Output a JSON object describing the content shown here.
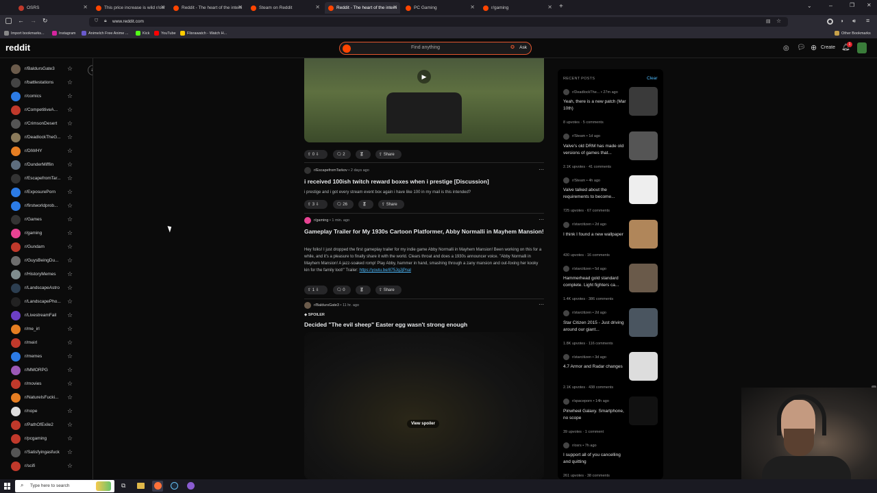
{
  "browser": {
    "tabs": [
      {
        "label": "OSRS",
        "color": "#c0392b"
      },
      {
        "label": "This price increase is wild r/osr",
        "color": "#ff4500"
      },
      {
        "label": "Reddit - The heart of the intern",
        "color": "#ff4500"
      },
      {
        "label": "Steam on Reddit",
        "color": "#ff4500"
      },
      {
        "label": "Reddit - The heart of the intern",
        "color": "#ff4500"
      },
      {
        "label": "PC Gaming",
        "color": "#ff4500"
      },
      {
        "label": "r/gaming",
        "color": "#ff4500"
      }
    ],
    "new_tab": "+",
    "url": "www.reddit.com",
    "bookmarks": [
      {
        "label": "Import bookmarks...",
        "color": "#888"
      },
      {
        "label": "Instagram",
        "color": "#d6249f"
      },
      {
        "label": "Animelch Free Anime ...",
        "color": "#6a5acd"
      },
      {
        "label": "Kick",
        "color": "#53fc18"
      },
      {
        "label": "YouTube",
        "color": "#ff0000"
      },
      {
        "label": "Flixrawatch - Watch H...",
        "color": "#ffcc00"
      }
    ],
    "other_bookmarks": "Other Bookmarks"
  },
  "header": {
    "logo": "reddit",
    "search_placeholder": "Find anything",
    "ask_label": "Ask",
    "create_label": "Create",
    "notif_count": "1"
  },
  "sidebar": {
    "items": [
      {
        "name": "r/BaldursGate3",
        "color": "#6b5b4b"
      },
      {
        "name": "r/battlestations",
        "color": "#444"
      },
      {
        "name": "r/comics",
        "color": "#2c7be5"
      },
      {
        "name": "r/CompetitiveA...",
        "color": "#c0392b"
      },
      {
        "name": "r/CrimsonDesert",
        "color": "#555"
      },
      {
        "name": "r/DeadlockTheG...",
        "color": "#8a7a5a"
      },
      {
        "name": "r/DIWHY",
        "color": "#e67e22"
      },
      {
        "name": "r/DunderMifflin",
        "color": "#5d6d7e"
      },
      {
        "name": "r/EscapefromTar...",
        "color": "#333"
      },
      {
        "name": "r/ExposurePorn",
        "color": "#2c7be5"
      },
      {
        "name": "r/firstworldprob...",
        "color": "#2c7be5"
      },
      {
        "name": "r/Games",
        "color": "#333"
      },
      {
        "name": "r/gaming",
        "color": "#e84393"
      },
      {
        "name": "r/Gundam",
        "color": "#c0392b"
      },
      {
        "name": "r/GuysBeingDu...",
        "color": "#6d6d6d"
      },
      {
        "name": "r/HistoryMemes",
        "color": "#7f8c8d"
      },
      {
        "name": "r/LandscapeAstro",
        "color": "#2c3e50"
      },
      {
        "name": "r/LandscapePho...",
        "color": "#222"
      },
      {
        "name": "r/LivestreamFail",
        "color": "#6c3fc5"
      },
      {
        "name": "r/me_irl",
        "color": "#e67e22"
      },
      {
        "name": "r/meirl",
        "color": "#c0392b"
      },
      {
        "name": "r/memes",
        "color": "#2c7be5"
      },
      {
        "name": "r/MMORPG",
        "color": "#9b59b6"
      },
      {
        "name": "r/movies",
        "color": "#c0392b"
      },
      {
        "name": "r/NatureIsFucki...",
        "color": "#e67e22"
      },
      {
        "name": "r/nope",
        "color": "#ddd"
      },
      {
        "name": "r/PathOfExile2",
        "color": "#c0392b"
      },
      {
        "name": "r/pcgaming",
        "color": "#c0392b"
      },
      {
        "name": "r/Satisfyingasfuck",
        "color": "#555"
      },
      {
        "name": "r/scifi",
        "color": "#c0392b"
      }
    ]
  },
  "feed": {
    "video_post": {
      "votes": "0",
      "comments": "2",
      "share": "Share"
    },
    "post1": {
      "sub": "r/EscapefromTarkov",
      "time": "2 days ago",
      "title": "i received 100ish twitch reward boxes when i prestige [Discussion]",
      "body": "i prestige and i got every stream event box again i have like 100 in my mail is this intended?",
      "votes": "3",
      "comments": "26",
      "share": "Share"
    },
    "post2": {
      "sub": "r/gaming",
      "time": "1 min. ago",
      "title": "Gameplay Trailer for My 1930s Cartoon Platformer, Abby Normalli in Mayhem Mansion!",
      "body": "Hey folks! I just dropped the first gameplay trailer for my indie game Abby Normalli in Mayhem Mansion! Been working on this for a while, and it's a pleasure to finally share it with the world. Clears throat and does a 1930s announcer voice. \"Abby Normalli in Mayhem Mansion! A jazz-soaked romp! Play Abby, hammer in hand, smashing through a zany mansion and out-foxing her kooky kin for the family loot!\" Trailer: ",
      "link": "https://youtu.be/875JqJjPnal",
      "votes": "1",
      "comments": "0",
      "share": "Share"
    },
    "post3": {
      "sub": "r/BaldursGate3",
      "time": "11 hr. ago",
      "spoiler_tag": "SPOILER",
      "title": "Decided \"The evil sheep\" Easter egg wasn't strong enough",
      "view_spoiler": "View spoiler"
    }
  },
  "recent": {
    "heading": "RECENT POSTS",
    "clear": "Clear",
    "posts": [
      {
        "sub": "r/DeadlockThe...",
        "time": "27m ago",
        "title": "Yeah, there is a new patch (Mar 10th)",
        "stats": "8 upvotes · 5 comments",
        "thumb": "#3a3a3a"
      },
      {
        "sub": "r/Steam",
        "time": "1d ago",
        "title": "Valve's old DRM has made old versions of games that...",
        "stats": "2.1K upvotes · 41 comments",
        "thumb": "#555"
      },
      {
        "sub": "r/Steam",
        "time": "4h ago",
        "title": "Valve talked about the requirements to become...",
        "stats": "725 upvotes · 67 comments",
        "thumb": "#eee"
      },
      {
        "sub": "r/starcitizen",
        "time": "2d ago",
        "title": "I think I found a new wallpaper",
        "stats": "430 upvotes · 16 comments",
        "thumb": "#b0865a"
      },
      {
        "sub": "r/starcitizen",
        "time": "5d ago",
        "title": "Hammerhead gold standard complete. Light fighters ca...",
        "stats": "1.4K upvotes · 386 comments",
        "thumb": "#6a5a4a"
      },
      {
        "sub": "r/starcitizen",
        "time": "2d ago",
        "title": "Star Citizen 2015 - Just driving around our giant...",
        "stats": "1.8K upvotes · 116 comments",
        "thumb": "#4a5560"
      },
      {
        "sub": "r/starcitizen",
        "time": "3d ago",
        "title": "4.7 Armor and Radar changes",
        "stats": "2.1K upvotes · 438 comments",
        "thumb": "#ddd"
      },
      {
        "sub": "r/spaceporn",
        "time": "14h ago",
        "title": "Pinwheel Galaxy. Smartphone, no scope",
        "stats": "39 upvotes · 1 comment",
        "thumb": "#111"
      },
      {
        "sub": "r/osrs",
        "time": "7h ago",
        "title": "I support all of you cancelling and quitting",
        "stats": "261 upvotes · 38 comments",
        "thumb": "#000"
      }
    ]
  },
  "taskbar": {
    "search_placeholder": "Type here to search"
  }
}
